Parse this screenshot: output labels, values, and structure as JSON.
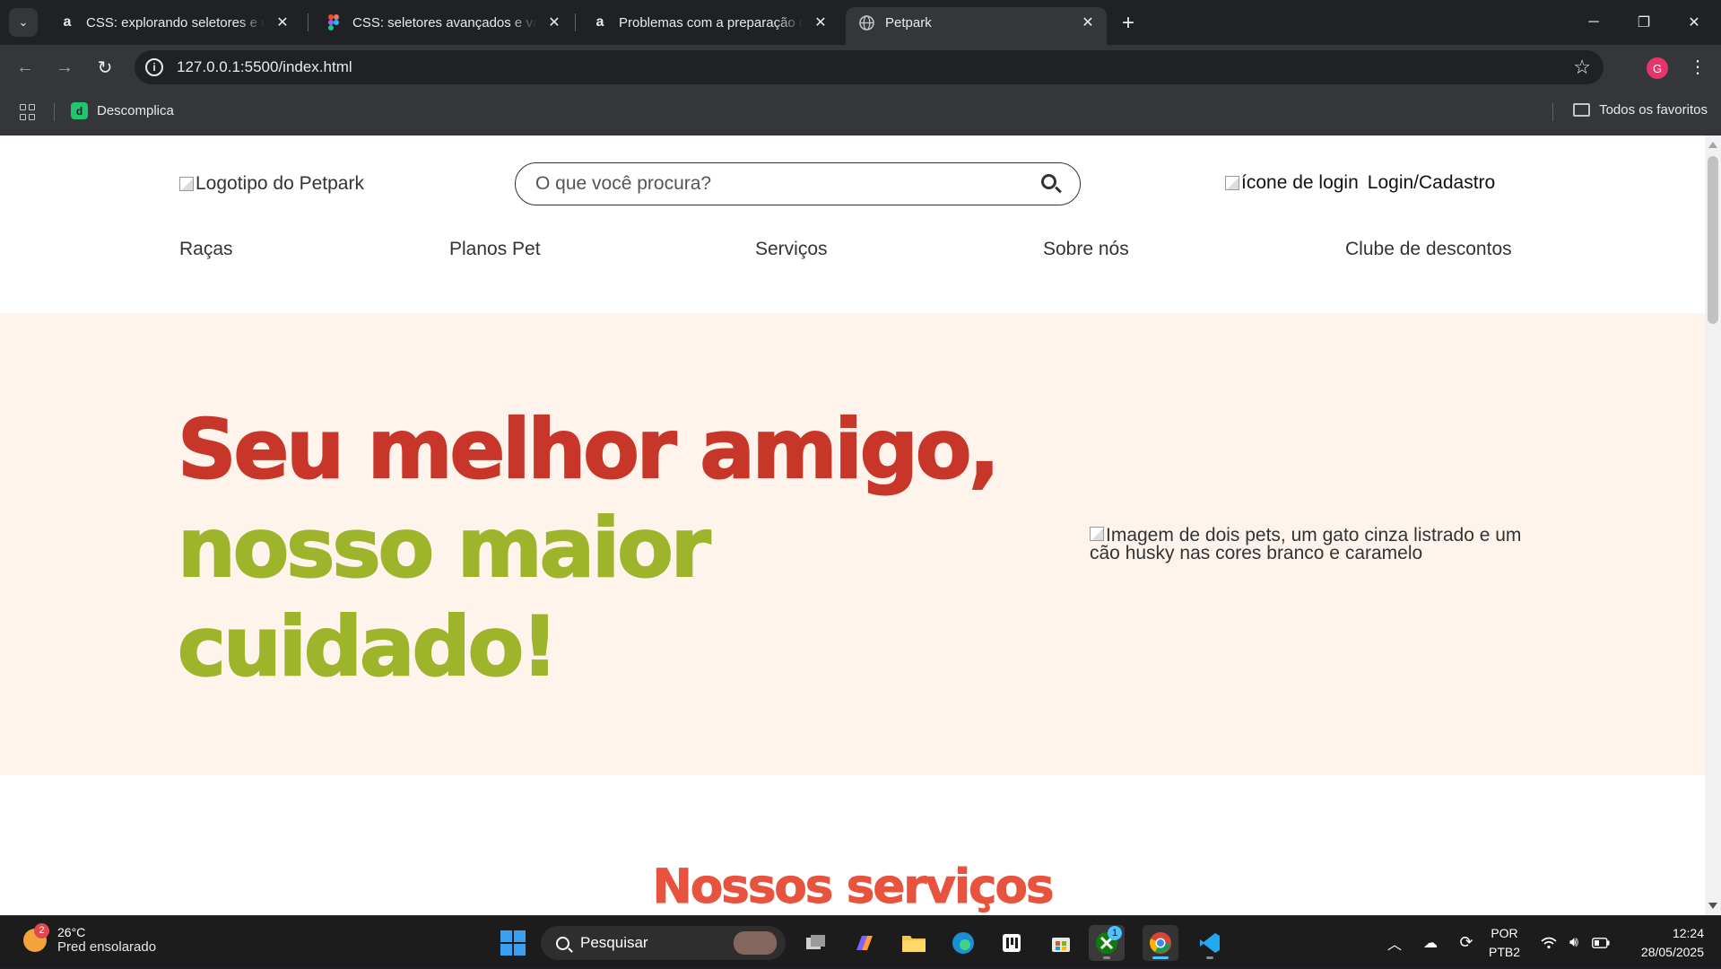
{
  "browser": {
    "tabs": [
      {
        "title": "CSS: explorando seletores e utilitários",
        "favicon": "alura-icon"
      },
      {
        "title": "CSS: seletores avançados e variáveis",
        "favicon": "figma-icon"
      },
      {
        "title": "Problemas com a preparação do ambiente",
        "favicon": "alura-icon"
      },
      {
        "title": "Petpark",
        "favicon": "globe-icon",
        "active": true
      }
    ],
    "url": "127.0.0.1:5500/index.html",
    "profile_initial": "G",
    "bookmarks": [
      {
        "label": "Descomplica"
      }
    ],
    "all_bookmarks_label": "Todos os favoritos"
  },
  "page": {
    "logo_alt": "Logotipo do Petpark",
    "search_placeholder": "O que você procura?",
    "login_icon_alt": "ícone de login",
    "login_label": "Login/Cadastro",
    "nav": [
      "Raças",
      "Planos Pet",
      "Serviços",
      "Sobre nós",
      "Clube de descontos"
    ],
    "hero": {
      "line1": "Seu melhor amigo,",
      "line2": "nosso maior cuidado!",
      "image_alt": "Imagem de dois pets, um gato cinza listrado e um cão husky nas cores branco e caramelo"
    },
    "services_title": "Nossos serviços",
    "colors": {
      "hero_bg": "#fef4ec",
      "red": "#c8362a",
      "green": "#9eb42b",
      "services": "#e8533e"
    }
  },
  "taskbar": {
    "weather_temp": "26°C",
    "weather_desc": "Pred ensolarado",
    "weather_badge": "2",
    "search_label": "Pesquisar",
    "xbox_badge": "1",
    "lang_top": "POR",
    "lang_bottom": "PTB2",
    "time": "12:24",
    "date": "28/05/2025"
  }
}
